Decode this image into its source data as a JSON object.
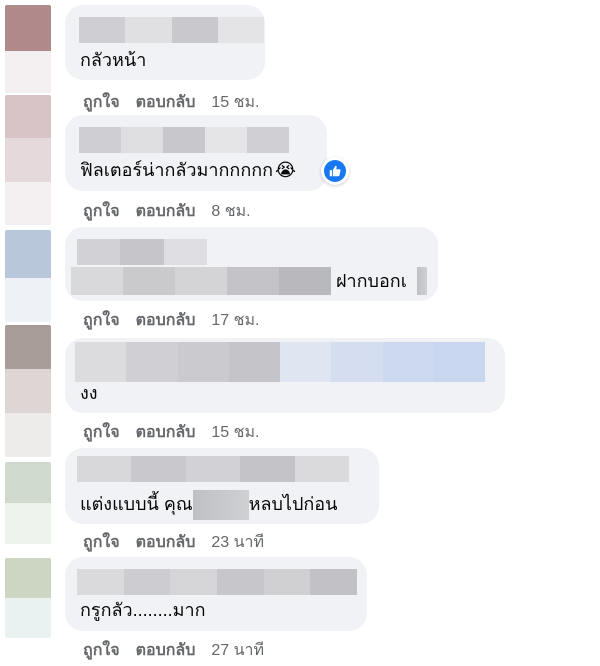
{
  "comments": [
    {
      "text": "กลัวหน้า",
      "like_label": "ถูกใจ",
      "reply_label": "ตอบกลับ",
      "time": "15 ชม.",
      "avatar_colors": [
        "#b08a8a",
        "#f1e8ea"
      ]
    },
    {
      "text": "ฟิลเตอร์น่ากลัวมากกกกก",
      "emoji": "😭",
      "like_label": "ถูกใจ",
      "reply_label": "ตอบกลับ",
      "time": "8 ชม.",
      "reaction_icon": "thumbs-up-icon",
      "avatar_colors": [
        "#d9c6c8",
        "#e8dcdf",
        "#f3eef0"
      ]
    },
    {
      "text": "ฝากบอกเ",
      "like_label": "ถูกใจ",
      "reply_label": "ตอบกลับ",
      "time": "17 ชม.",
      "avatar_colors": [
        "#b9c8da",
        "#e9eef4"
      ]
    },
    {
      "text": "งง",
      "like_label": "ถูกใจ",
      "reply_label": "ตอบกลับ",
      "time": "15 ชม.",
      "avatar_colors": [
        "#a89c98",
        "#ddd6d4",
        "#ecebe9"
      ]
    },
    {
      "text_before": "แต่งแบบนี้ คุณ",
      "text_after": "หลบไปก่อน",
      "like_label": "ถูกใจ",
      "reply_label": "ตอบกลับ",
      "time": "23 นาที",
      "avatar_colors": [
        "#cfd9cc",
        "#edf1ec"
      ]
    },
    {
      "text": "กรูกลัว........มาก",
      "like_label": "ถูกใจ",
      "reply_label": "ตอบกลับ",
      "time": "27 นาที",
      "avatar_colors": [
        "#cdd6c2",
        "#e9f2f1"
      ]
    }
  ],
  "colors": {
    "bubble": "#f0f2f5",
    "meta_text": "#65676b",
    "like_blue": "#1877f2"
  }
}
